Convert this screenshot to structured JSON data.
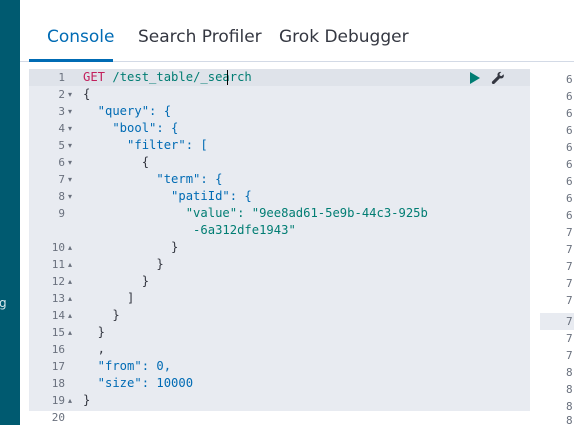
{
  "sidebar": {
    "truncated_label": "g"
  },
  "tabs": [
    {
      "label": "Console",
      "active": true
    },
    {
      "label": "Search Profiler",
      "active": false
    },
    {
      "label": "Grok Debugger",
      "active": false
    }
  ],
  "editor": {
    "method": "GET",
    "path": "/test_table/_search",
    "actions": {
      "run_icon": "play-icon",
      "settings_icon": "wrench-icon"
    },
    "line_numbers": [
      "1",
      "2",
      "3",
      "4",
      "5",
      "6",
      "7",
      "8",
      "9",
      "10",
      "11",
      "12",
      "13",
      "14",
      "15",
      "16",
      "17",
      "18",
      "19",
      "20"
    ],
    "lines": [
      "{",
      "  \"query\": {",
      "    \"bool\": {",
      "      \"filter\": [",
      "        {",
      "          \"term\": {",
      "            \"patiId\": {",
      "              \"value\": \"9ee8ad61-5e9b-44c3-925b",
      "               -6a312dfe1943\"",
      "            }",
      "          }",
      "        }",
      "      ]",
      "    }",
      "  }",
      "  ,",
      "  \"from\": 0,",
      "  \"size\": 10000",
      "}"
    ]
  },
  "output": {
    "line_numbers": [
      "6",
      "6",
      "6",
      "6",
      "6",
      "6",
      "6",
      "6",
      "6",
      "7",
      "7",
      "7",
      "7",
      "7",
      "7",
      "7",
      "7",
      "8",
      "8",
      "8",
      "8"
    ]
  },
  "colors": {
    "rail": "#005a70",
    "accent": "#006bb4",
    "editor_bg": "#e8ebf1",
    "method": "#c21f5c",
    "string": "#017d73"
  }
}
